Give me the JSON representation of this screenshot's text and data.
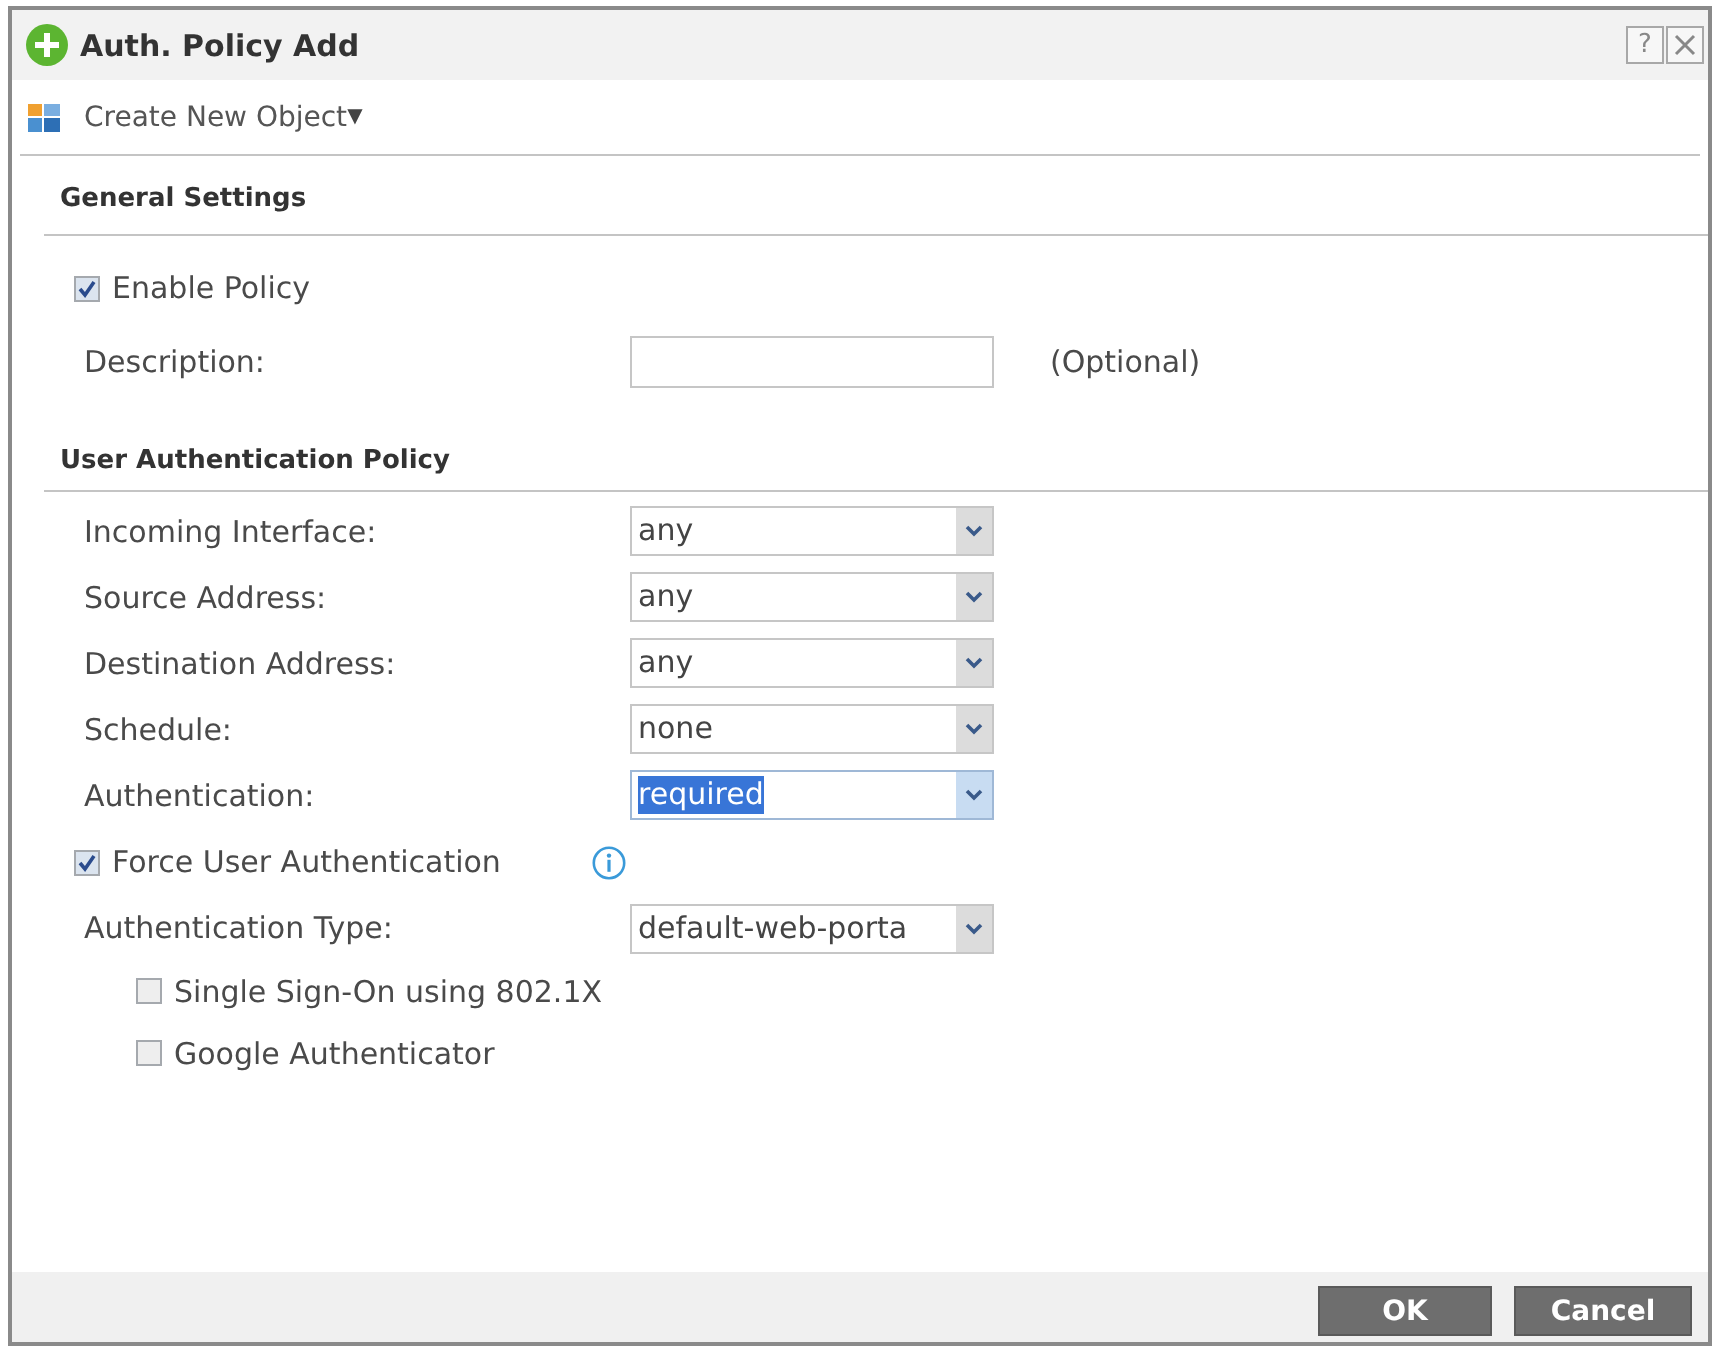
{
  "window": {
    "title": "Auth. Policy Add",
    "help_button": "?"
  },
  "toolbar": {
    "menu": {
      "label": "Create New Object",
      "caret": "▼"
    }
  },
  "sections": [
    {
      "title": "General Settings",
      "rows": [
        {
          "kind": "checkbox",
          "label": "Enable Policy",
          "checked": true,
          "info": false
        },
        {
          "kind": "text",
          "label": "Description:",
          "note": "(Optional)"
        }
      ]
    },
    {
      "title": "User Authentication Policy",
      "rows": [
        {
          "kind": "select",
          "label": "Incoming Interface:",
          "value": "any",
          "highlighted": false
        },
        {
          "kind": "select",
          "label": "Source Address:",
          "value": "any",
          "highlighted": false
        },
        {
          "kind": "select",
          "label": "Destination Address:",
          "value": "any",
          "highlighted": false
        },
        {
          "kind": "select",
          "label": "Schedule:",
          "value": "none",
          "highlighted": false
        },
        {
          "kind": "select",
          "label": "Authentication:",
          "value": "required",
          "highlighted": true
        },
        {
          "kind": "checkbox",
          "label": "Force User Authentication",
          "checked": true,
          "info": true
        },
        {
          "kind": "select",
          "label": "Authentication Type:",
          "value": "default-web-porta",
          "highlighted": false,
          "children": [
            {
              "kind": "checkbox",
              "label": "Single Sign-On using 802.1X",
              "checked": false,
              "info": false
            },
            {
              "kind": "checkbox",
              "label": "Google Authenticator",
              "checked": false,
              "info": false
            }
          ]
        }
      ]
    }
  ],
  "buttons": [
    "OK",
    "Cancel"
  ]
}
